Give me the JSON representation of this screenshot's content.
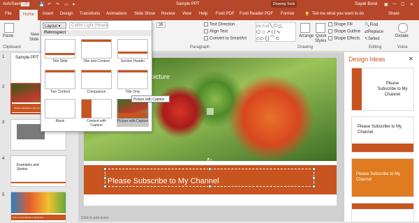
{
  "titlebar": {
    "autosave": "AutoSave",
    "autosave_state": "Off",
    "filename": "Sample PPT",
    "context_tab": "Drawing Tools",
    "user": "Sayak Boral"
  },
  "tabs": [
    {
      "label": "File"
    },
    {
      "label": "Home"
    },
    {
      "label": "Insert"
    },
    {
      "label": "Design"
    },
    {
      "label": "Transitions"
    },
    {
      "label": "Animations"
    },
    {
      "label": "Slide Show"
    },
    {
      "label": "Review"
    },
    {
      "label": "View"
    },
    {
      "label": "Help"
    },
    {
      "label": "Foxit PDF"
    },
    {
      "label": "Foxit Reader PDF"
    },
    {
      "label": "Format"
    }
  ],
  "tell_me": "Tell me what you want to do",
  "share": "Share",
  "ribbon": {
    "paste": "Paste",
    "new": "New",
    "slide": "Slide",
    "clipboard": "Clipboard",
    "font": "Calibri Light (Headings",
    "size": "36",
    "text_direction": "Text Direction",
    "align_text": "Align Text",
    "smartart": "Convert to SmartArt",
    "paragraph": "Paragraph",
    "drawing": "Drawing",
    "arrange": "Arrange",
    "quick": "Quick",
    "styles": "Styles",
    "shape_fill": "Shape Fill",
    "shape_outline": "Shape Outline",
    "shape_effects": "Shape Effects",
    "find": "Find",
    "replace": "Replace",
    "select": "Select",
    "editing": "Editing",
    "dictate": "Dictate",
    "voice": "Voice"
  },
  "layout_menu": {
    "button": "Layout",
    "header": "Retrospect",
    "items": [
      {
        "label": "Title Slide"
      },
      {
        "label": "Title and Content"
      },
      {
        "label": "Section Header"
      },
      {
        "label": "Two Content"
      },
      {
        "label": "Comparison"
      },
      {
        "label": "Title Only"
      },
      {
        "label": "Blank"
      },
      {
        "label": "Content with Caption"
      },
      {
        "label": "Picture with Caption"
      }
    ],
    "tooltip": "Picture with Caption"
  },
  "thumbnails": [
    {
      "num": "1",
      "title": "Sample PPT"
    },
    {
      "num": "2",
      "caption": "Please Subscribe to My Channel"
    },
    {
      "num": "3",
      "caption": ""
    },
    {
      "num": "4",
      "title": "Examples and Stories"
    },
    {
      "num": "5",
      "caption": "Why Is It the Benefit of Illustration"
    }
  ],
  "slide": {
    "placeholder": "picture",
    "caption_title": "Please Subscribe to My Channel",
    "notes": "Click to add notes"
  },
  "design_ideas": {
    "header": "Design Ideas",
    "cards": [
      {
        "text": "Please Subscribe to My Channel"
      },
      {
        "text": "Please Subscribe to My Channel"
      },
      {
        "text": "Please Subscribe to My Channel"
      }
    ]
  },
  "colors": {
    "accent": "#b7472a",
    "orange": "#c8541f"
  }
}
